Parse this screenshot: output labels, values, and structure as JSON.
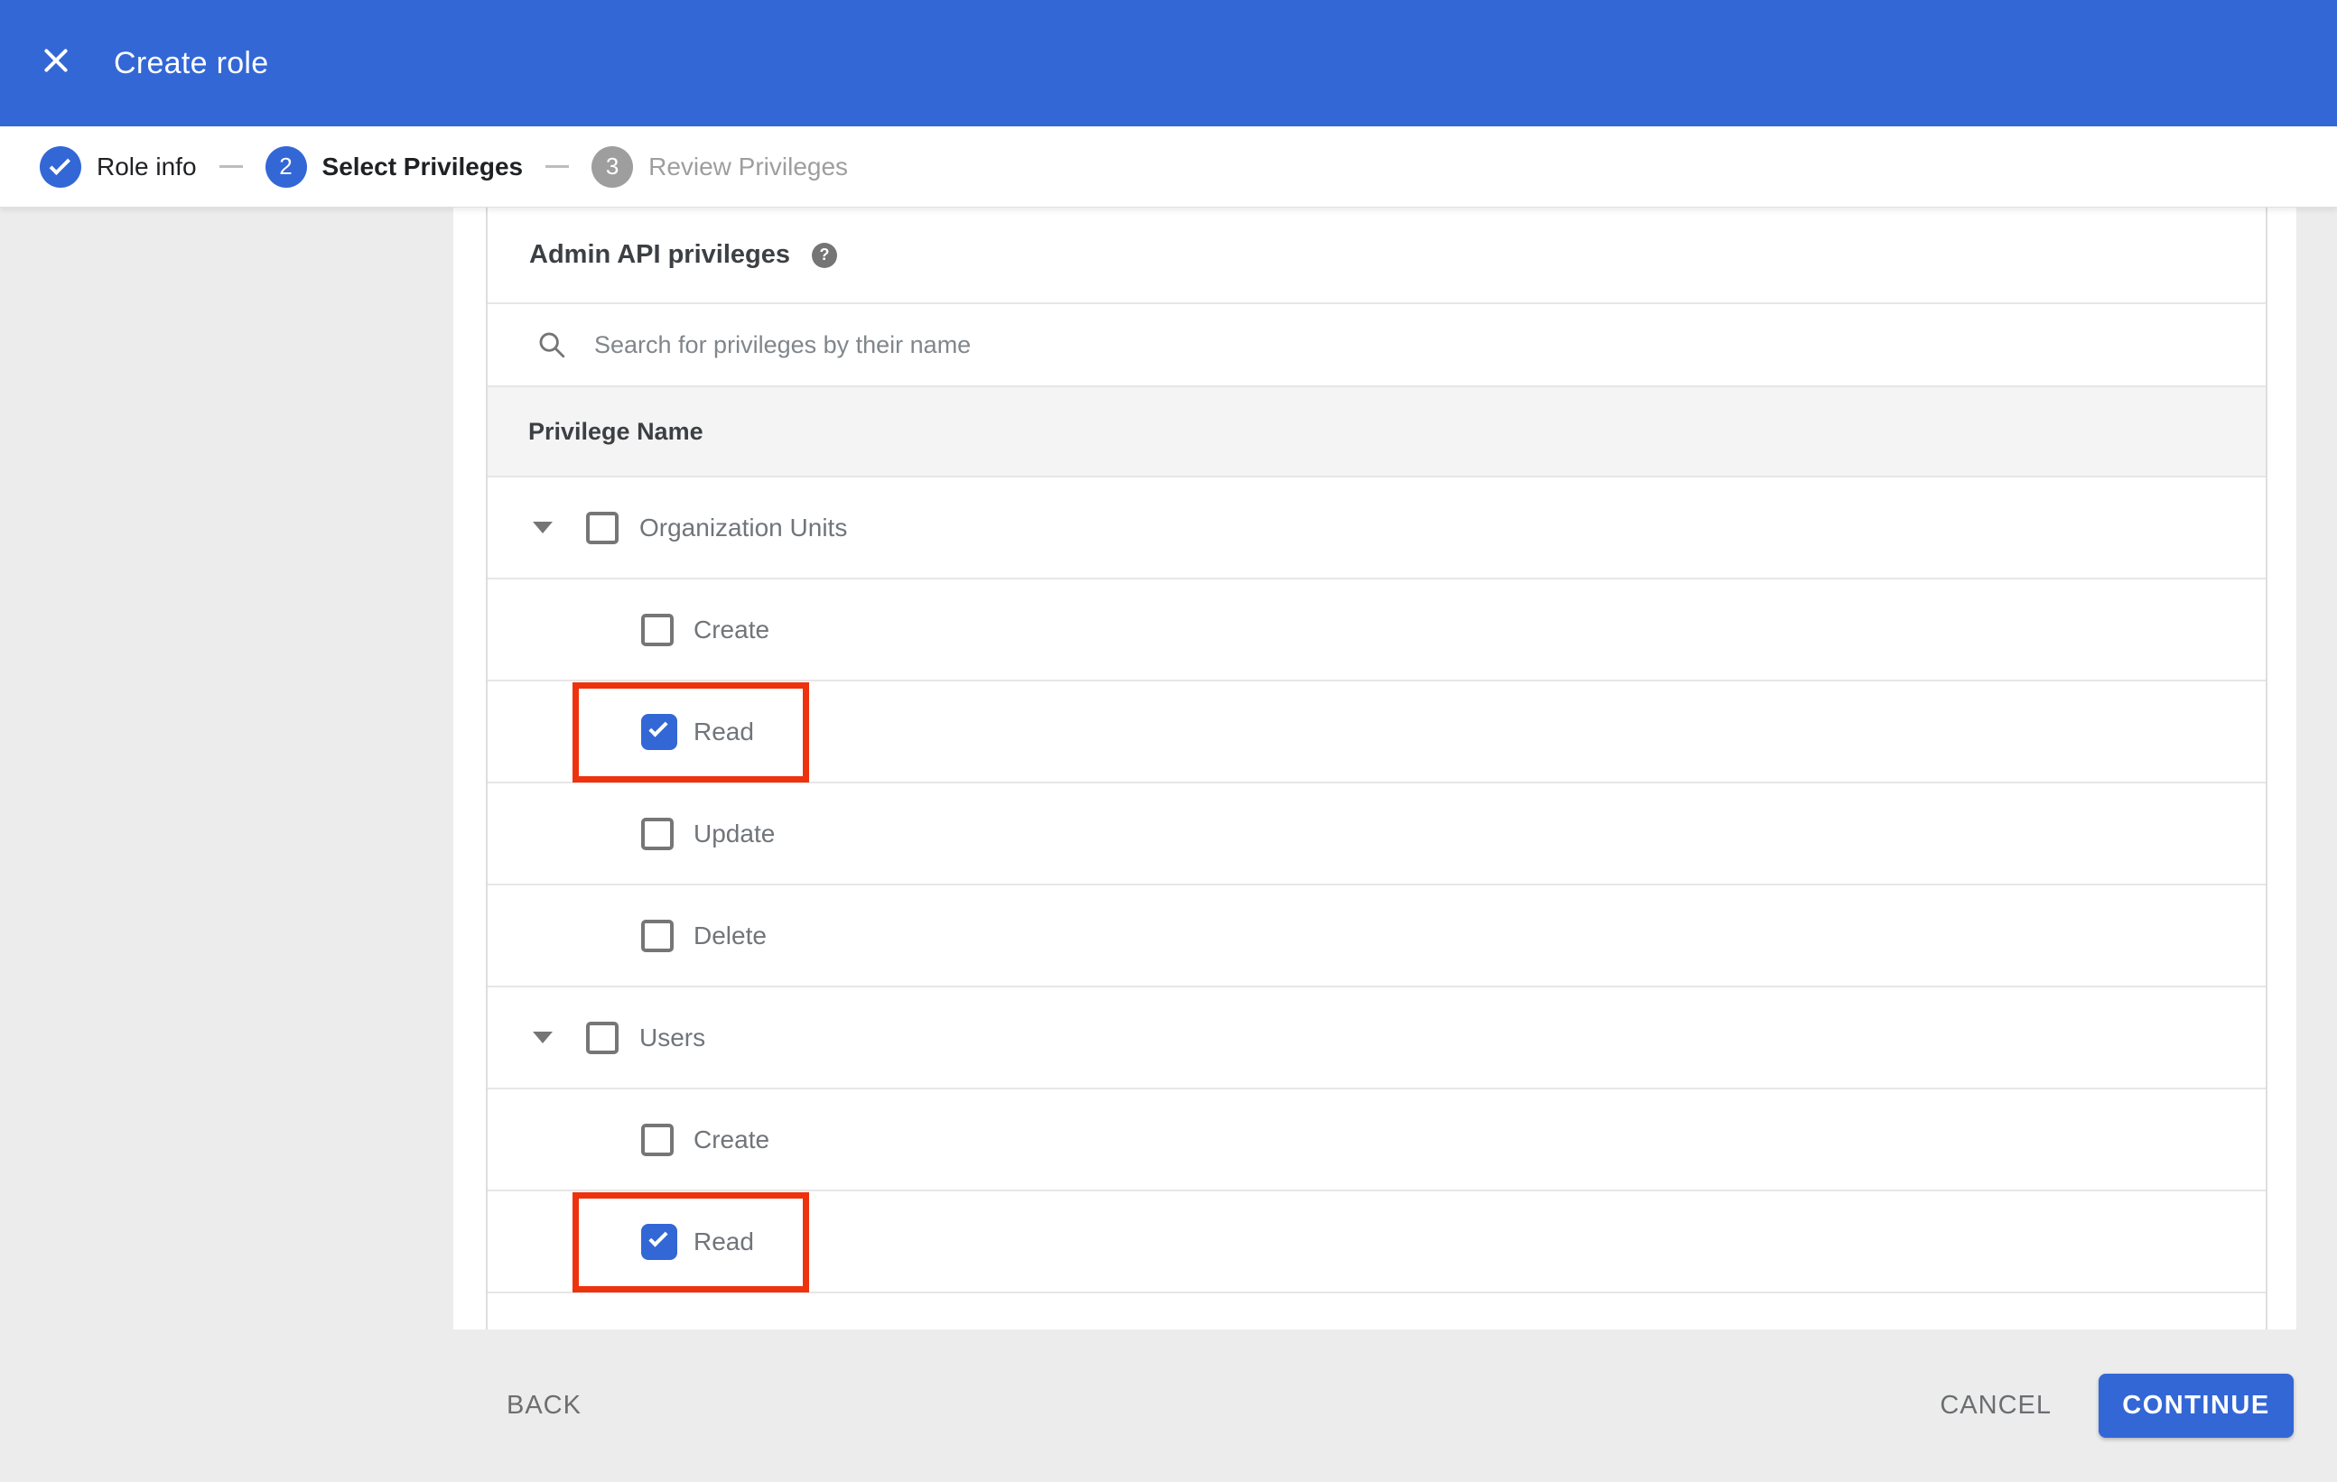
{
  "appbar": {
    "title": "Create role",
    "close_icon": "x-icon"
  },
  "stepper": {
    "steps": [
      {
        "number": "1",
        "label": "Role info",
        "state": "complete",
        "icon": "checkmark-icon"
      },
      {
        "number": "2",
        "label": "Select Privileges",
        "state": "active"
      },
      {
        "number": "3",
        "label": "Review Privileges",
        "state": "upcoming"
      }
    ]
  },
  "content": {
    "heading": "Admin API privileges",
    "help_icon": "?",
    "search_placeholder": "Search for privileges by their name",
    "search_value": "",
    "table_header": "Privilege Name",
    "rows": [
      {
        "type": "group",
        "label": "Organization Units",
        "checked": false,
        "expanded": true,
        "highlighted": false
      },
      {
        "type": "child",
        "label": "Create",
        "checked": false,
        "highlighted": false
      },
      {
        "type": "child",
        "label": "Read",
        "checked": true,
        "highlighted": true
      },
      {
        "type": "child",
        "label": "Update",
        "checked": false,
        "highlighted": false
      },
      {
        "type": "child",
        "label": "Delete",
        "checked": false,
        "highlighted": false
      },
      {
        "type": "group",
        "label": "Users",
        "checked": false,
        "expanded": true,
        "highlighted": false
      },
      {
        "type": "child",
        "label": "Create",
        "checked": false,
        "highlighted": false
      },
      {
        "type": "child",
        "label": "Read",
        "checked": true,
        "highlighted": true
      }
    ]
  },
  "footer": {
    "back_label": "BACK",
    "cancel_label": "CANCEL",
    "continue_label": "CONTINUE"
  },
  "colors": {
    "accent_blue": "#3367d6",
    "highlight_red": "#ee320e",
    "page_background": "#ececec",
    "inactive_step_gray": "#9e9e9e"
  }
}
